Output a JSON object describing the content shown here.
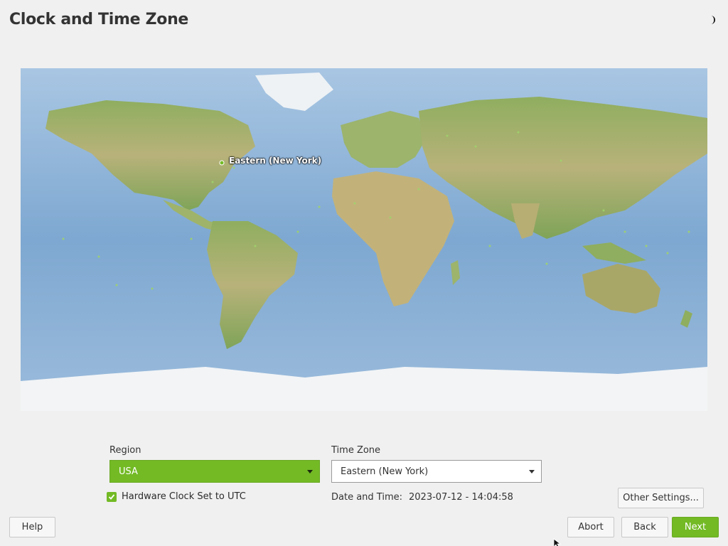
{
  "header": {
    "title": "Clock and Time Zone",
    "theme_icon": "half-moon-icon"
  },
  "map": {
    "selected_marker_label": "Eastern (New York)",
    "marker_color": "#73ba25"
  },
  "region": {
    "label": "Region",
    "value": "USA"
  },
  "timezone": {
    "label": "Time Zone",
    "value": "Eastern (New York)"
  },
  "hardware_clock": {
    "label": "Hardware Clock Set to UTC",
    "checked": true
  },
  "datetime": {
    "label": "Date and Time:",
    "value": "2023-07-12 - 14:04:58"
  },
  "buttons": {
    "other_settings": "Other Settings...",
    "help": "Help",
    "abort": "Abort",
    "back": "Back",
    "next": "Next"
  },
  "colors": {
    "accent": "#73ba25",
    "background": "#f0f0f0",
    "ocean": "#8fb6d9"
  }
}
